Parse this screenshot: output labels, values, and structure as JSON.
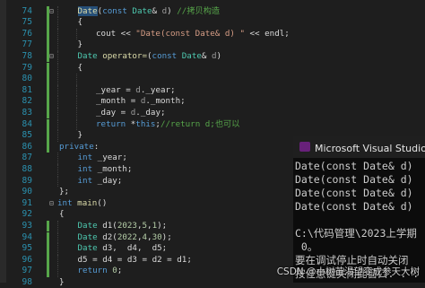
{
  "editor": {
    "colors": {
      "keyword": "#569cd6",
      "type": "#4ec9b0",
      "function": "#dcdcaa",
      "string": "#d69d85",
      "comment": "#57a64a",
      "number": "#b5cea8",
      "param": "#9a9a9a",
      "member": "#dadada",
      "plain": "#dcdcdc",
      "line_number": "#2b91af"
    },
    "lines": [
      {
        "num": "74",
        "fold": "⊟",
        "indent": 1,
        "changed": true,
        "tokens": [
          {
            "t": "Date",
            "c": "function",
            "hl": true
          },
          {
            "t": "(",
            "c": "plain"
          },
          {
            "t": "const",
            "c": "keyword"
          },
          {
            "t": " ",
            "c": "plain"
          },
          {
            "t": "Date",
            "c": "type"
          },
          {
            "t": "& ",
            "c": "plain"
          },
          {
            "t": "d",
            "c": "param"
          },
          {
            "t": ") ",
            "c": "plain"
          },
          {
            "t": "//拷贝构造",
            "c": "comment"
          }
        ]
      },
      {
        "num": "75",
        "fold": "",
        "indent": 1,
        "changed": true,
        "tokens": [
          {
            "t": "{",
            "c": "plain"
          }
        ]
      },
      {
        "num": "76",
        "fold": "",
        "indent": 2,
        "changed": true,
        "tokens": [
          {
            "t": "cout",
            "c": "member"
          },
          {
            "t": " << ",
            "c": "plain"
          },
          {
            "t": "\"Date(const Date& d) \"",
            "c": "string"
          },
          {
            "t": " << ",
            "c": "plain"
          },
          {
            "t": "endl",
            "c": "member"
          },
          {
            "t": ";",
            "c": "plain"
          }
        ]
      },
      {
        "num": "77",
        "fold": "",
        "indent": 1,
        "changed": true,
        "tokens": [
          {
            "t": "}",
            "c": "plain"
          }
        ]
      },
      {
        "num": "78",
        "fold": "⊟",
        "indent": 1,
        "changed": true,
        "tokens": [
          {
            "t": "Date",
            "c": "type"
          },
          {
            "t": " ",
            "c": "plain"
          },
          {
            "t": "operator=",
            "c": "function"
          },
          {
            "t": "(",
            "c": "plain"
          },
          {
            "t": "const",
            "c": "keyword"
          },
          {
            "t": " ",
            "c": "plain"
          },
          {
            "t": "Date",
            "c": "type"
          },
          {
            "t": "& ",
            "c": "plain"
          },
          {
            "t": "d",
            "c": "param"
          },
          {
            "t": ")",
            "c": "plain"
          }
        ]
      },
      {
        "num": "79",
        "fold": "",
        "indent": 1,
        "changed": true,
        "tokens": [
          {
            "t": "{",
            "c": "plain"
          }
        ]
      },
      {
        "num": "80",
        "fold": "",
        "indent": 2,
        "changed": true,
        "tokens": []
      },
      {
        "num": "81",
        "fold": "",
        "indent": 2,
        "changed": true,
        "tokens": [
          {
            "t": "_year",
            "c": "member"
          },
          {
            "t": " = ",
            "c": "plain"
          },
          {
            "t": "d",
            "c": "param"
          },
          {
            "t": ".",
            "c": "plain"
          },
          {
            "t": "_year",
            "c": "member"
          },
          {
            "t": ";",
            "c": "plain"
          }
        ]
      },
      {
        "num": "82",
        "fold": "",
        "indent": 2,
        "changed": true,
        "tokens": [
          {
            "t": "_month",
            "c": "member"
          },
          {
            "t": " = ",
            "c": "plain"
          },
          {
            "t": "d",
            "c": "param"
          },
          {
            "t": ".",
            "c": "plain"
          },
          {
            "t": "_month",
            "c": "member"
          },
          {
            "t": ";",
            "c": "plain"
          }
        ]
      },
      {
        "num": "83",
        "fold": "",
        "indent": 2,
        "changed": true,
        "tokens": [
          {
            "t": "_day",
            "c": "member"
          },
          {
            "t": " = ",
            "c": "plain"
          },
          {
            "t": "d",
            "c": "param"
          },
          {
            "t": ".",
            "c": "plain"
          },
          {
            "t": "_day",
            "c": "member"
          },
          {
            "t": ";",
            "c": "plain"
          }
        ]
      },
      {
        "num": "84",
        "fold": "",
        "indent": 2,
        "changed": true,
        "tokens": [
          {
            "t": "return",
            "c": "keyword"
          },
          {
            "t": " *",
            "c": "plain"
          },
          {
            "t": "this",
            "c": "keyword"
          },
          {
            "t": ";",
            "c": "plain"
          },
          {
            "t": "//return d;也可以",
            "c": "comment"
          }
        ]
      },
      {
        "num": "85",
        "fold": "",
        "indent": 1,
        "changed": true,
        "tokens": [
          {
            "t": "}",
            "c": "plain"
          }
        ]
      },
      {
        "num": "86",
        "fold": "",
        "indent": 0,
        "changed": true,
        "tokens": [
          {
            "t": "private",
            "c": "keyword"
          },
          {
            "t": ":",
            "c": "plain"
          }
        ]
      },
      {
        "num": "87",
        "fold": "",
        "indent": 1,
        "changed": false,
        "tokens": [
          {
            "t": "int",
            "c": "keyword"
          },
          {
            "t": " ",
            "c": "plain"
          },
          {
            "t": "_year",
            "c": "member"
          },
          {
            "t": ";",
            "c": "plain"
          }
        ]
      },
      {
        "num": "88",
        "fold": "",
        "indent": 1,
        "changed": false,
        "tokens": [
          {
            "t": "int",
            "c": "keyword"
          },
          {
            "t": " ",
            "c": "plain"
          },
          {
            "t": "_month",
            "c": "member"
          },
          {
            "t": ";",
            "c": "plain"
          }
        ]
      },
      {
        "num": "89",
        "fold": "",
        "indent": 1,
        "changed": false,
        "tokens": [
          {
            "t": "int",
            "c": "keyword"
          },
          {
            "t": " ",
            "c": "plain"
          },
          {
            "t": "_day",
            "c": "member"
          },
          {
            "t": ";",
            "c": "plain"
          }
        ]
      },
      {
        "num": "90",
        "fold": "",
        "indent": 0,
        "changed": false,
        "tokens": [
          {
            "t": "};",
            "c": "plain"
          }
        ]
      },
      {
        "num": "91",
        "fold": "⊟",
        "indent": -1,
        "changed": false,
        "tokens": [
          {
            "t": "int",
            "c": "keyword"
          },
          {
            "t": " ",
            "c": "plain"
          },
          {
            "t": "main",
            "c": "function"
          },
          {
            "t": "()",
            "c": "plain"
          }
        ]
      },
      {
        "num": "92",
        "fold": "",
        "indent": 0,
        "changed": false,
        "tokens": [
          {
            "t": "{",
            "c": "plain"
          }
        ]
      },
      {
        "num": "93",
        "fold": "",
        "indent": 1,
        "changed": true,
        "tokens": [
          {
            "t": "Date",
            "c": "type"
          },
          {
            "t": " ",
            "c": "plain"
          },
          {
            "t": "d1",
            "c": "member"
          },
          {
            "t": "(",
            "c": "plain"
          },
          {
            "t": "2023",
            "c": "number"
          },
          {
            "t": ",",
            "c": "plain"
          },
          {
            "t": "5",
            "c": "number"
          },
          {
            "t": ",",
            "c": "plain"
          },
          {
            "t": "1",
            "c": "number"
          },
          {
            "t": ");",
            "c": "plain"
          }
        ]
      },
      {
        "num": "94",
        "fold": "",
        "indent": 1,
        "changed": true,
        "tokens": [
          {
            "t": "Date",
            "c": "type"
          },
          {
            "t": " ",
            "c": "plain"
          },
          {
            "t": "d2",
            "c": "member"
          },
          {
            "t": "(",
            "c": "plain"
          },
          {
            "t": "2022",
            "c": "number"
          },
          {
            "t": ",",
            "c": "plain"
          },
          {
            "t": "4",
            "c": "number"
          },
          {
            "t": ",",
            "c": "plain"
          },
          {
            "t": "30",
            "c": "number"
          },
          {
            "t": ");",
            "c": "plain"
          }
        ]
      },
      {
        "num": "95",
        "fold": "",
        "indent": 1,
        "changed": true,
        "tokens": [
          {
            "t": "Date",
            "c": "type"
          },
          {
            "t": " ",
            "c": "plain"
          },
          {
            "t": "d3",
            "c": "member"
          },
          {
            "t": ",  ",
            "c": "plain"
          },
          {
            "t": "d4",
            "c": "member"
          },
          {
            "t": ",  ",
            "c": "plain"
          },
          {
            "t": "d5",
            "c": "member"
          },
          {
            "t": ";",
            "c": "plain"
          }
        ]
      },
      {
        "num": "96",
        "fold": "",
        "indent": 1,
        "changed": true,
        "tokens": [
          {
            "t": "d5",
            "c": "member"
          },
          {
            "t": " = ",
            "c": "plain"
          },
          {
            "t": "d4",
            "c": "member"
          },
          {
            "t": " = ",
            "c": "plain"
          },
          {
            "t": "d3",
            "c": "member"
          },
          {
            "t": " = ",
            "c": "plain"
          },
          {
            "t": "d2",
            "c": "member"
          },
          {
            "t": " = ",
            "c": "plain"
          },
          {
            "t": "d1",
            "c": "member"
          },
          {
            "t": ";",
            "c": "plain"
          }
        ]
      },
      {
        "num": "97",
        "fold": "",
        "indent": 1,
        "changed": true,
        "tokens": [
          {
            "t": "return",
            "c": "keyword"
          },
          {
            "t": " ",
            "c": "plain"
          },
          {
            "t": "0",
            "c": "number"
          },
          {
            "t": ";",
            "c": "plain"
          }
        ]
      },
      {
        "num": "98",
        "fold": "",
        "indent": 0,
        "changed": false,
        "tokens": [
          {
            "t": "}",
            "c": "plain"
          }
        ]
      }
    ]
  },
  "console": {
    "title": "Microsoft Visual Studio 调",
    "lines": [
      "Date(const Date& d)",
      "Date(const Date& d)",
      "Date(const Date& d)",
      "Date(const Date& d)",
      "",
      "C:\\代码管理\\2023上学期",
      " 0。",
      "要在调试停止时自动关闭",
      "按任意键关闭此窗口. . ."
    ]
  },
  "watermark": "CSDN @小树苗渴望变成参天大树"
}
